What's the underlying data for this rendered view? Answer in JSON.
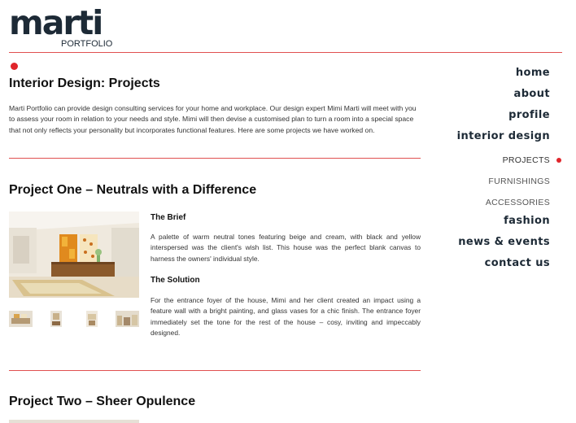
{
  "logo": {
    "word": "marti",
    "sub": "PORTFOLIO"
  },
  "nav": {
    "items": [
      {
        "label": "home"
      },
      {
        "label": "about"
      },
      {
        "label": "profile"
      },
      {
        "label": "interior design"
      }
    ],
    "sub_items": [
      {
        "label": "PROJECTS",
        "active": true
      },
      {
        "label": "FURNISHINGS",
        "active": false
      },
      {
        "label": "ACCESSORIES",
        "active": false
      }
    ],
    "items_after": [
      {
        "label": "fashion"
      },
      {
        "label": "news & events"
      },
      {
        "label": "contact us"
      }
    ]
  },
  "page": {
    "title": "Interior Design: Projects",
    "intro": "Marti Portfolio can provide design consulting services for your home and workplace. Our design expert Mimi Marti will meet with you to assess your room in relation to your needs and style. Mimi will then devise a customised plan to turn a room into a special space that not only reflects your personality but incorporates functional features. Here are some projects we have worked on."
  },
  "projects": [
    {
      "title": "Project One – Neutrals with a Difference",
      "brief_heading": "The Brief",
      "brief_text": "A palette of warm neutral tones featuring beige and cream, with black and yellow interspersed was the client's wish list. This house was the perfect blank canvas to harness the owners' individual style.",
      "solution_heading": "The Solution",
      "solution_text": "For the entrance foyer of the house, Mimi and her client created an impact using a feature wall with a bright painting, and glass vases for a chic finish. The entrance foyer immediately set the tone for the rest of the house – cosy, inviting and impeccably designed."
    },
    {
      "title": "Project Two – Sheer Opulence"
    }
  ],
  "colors": {
    "accent": "#e0252b",
    "brand": "#1d2a36",
    "rule": "#e05050"
  }
}
